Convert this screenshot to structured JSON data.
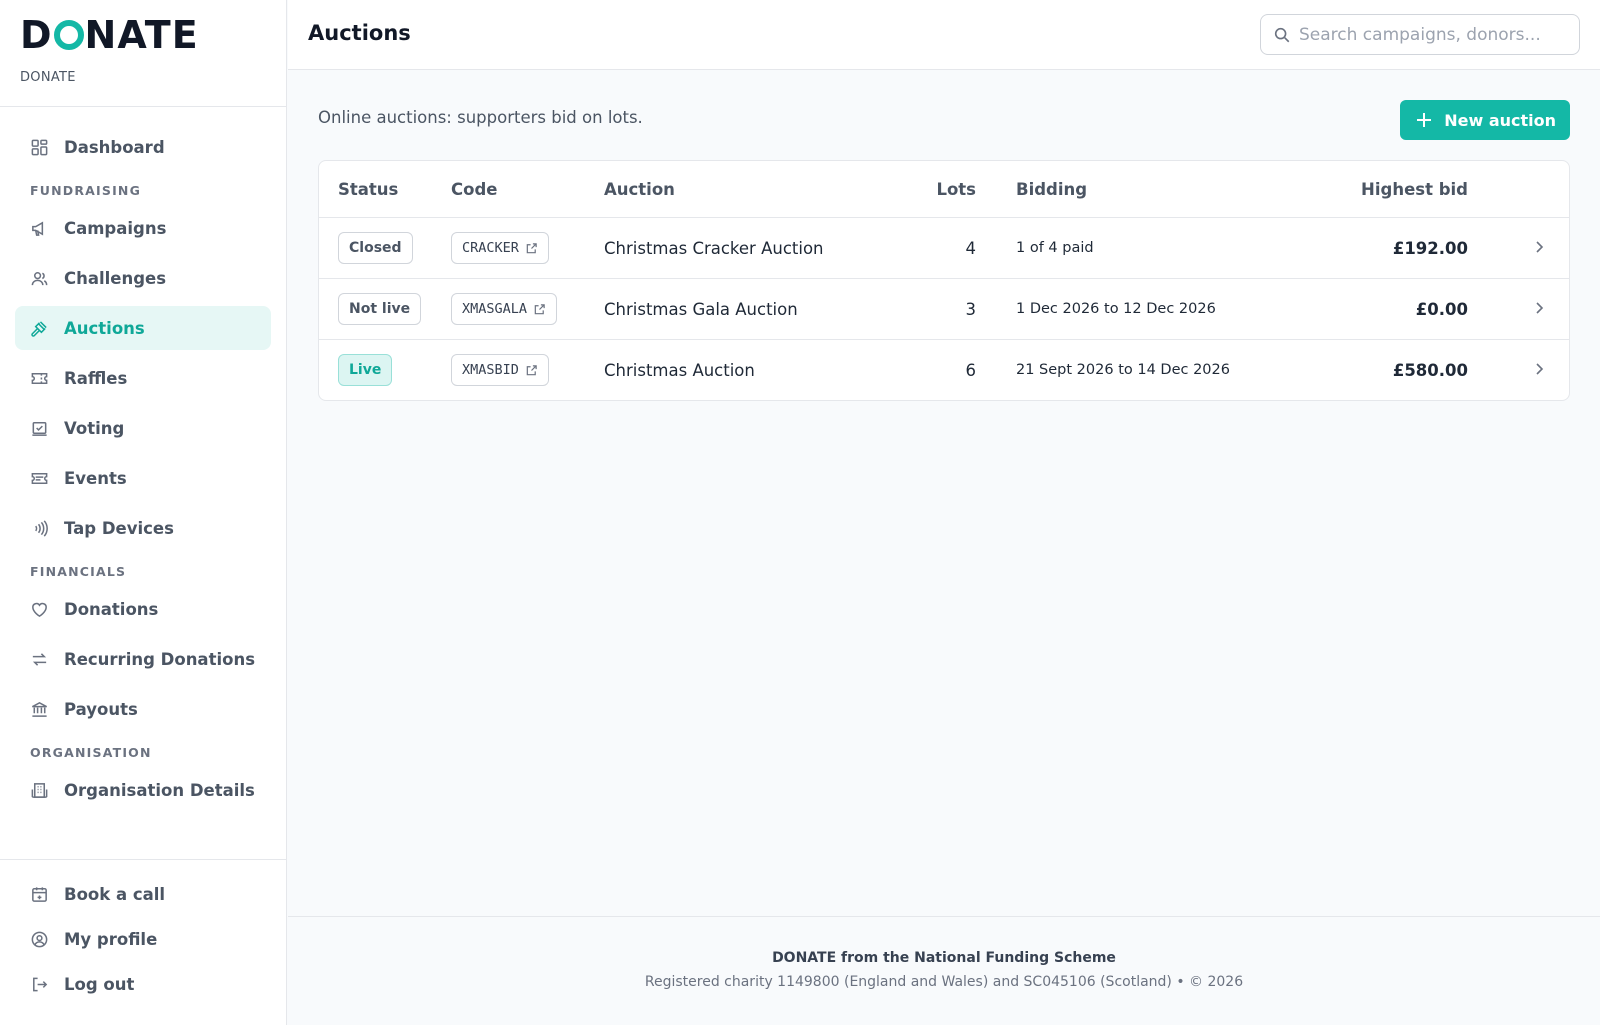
{
  "brand": {
    "logo": "DONATE",
    "subtitle": "DONATE"
  },
  "header": {
    "title": "Auctions",
    "search_placeholder": "Search campaigns, donors..."
  },
  "nav": {
    "dashboard": "Dashboard",
    "section_fundraising": "FUNDRAISING",
    "campaigns": "Campaigns",
    "challenges": "Challenges",
    "auctions": "Auctions",
    "raffles": "Raffles",
    "voting": "Voting",
    "events": "Events",
    "tap_devices": "Tap Devices",
    "section_financials": "FINANCIALS",
    "donations": "Donations",
    "recurring_donations": "Recurring Donations",
    "payouts": "Payouts",
    "section_organisation": "ORGANISATION",
    "organisation_details": "Organisation Details",
    "book_call": "Book a call",
    "my_profile": "My profile",
    "log_out": "Log out"
  },
  "main": {
    "description": "Online auctions: supporters bid on lots.",
    "new_button": "New auction"
  },
  "table": {
    "headers": {
      "status": "Status",
      "code": "Code",
      "auction": "Auction",
      "lots": "Lots",
      "bidding": "Bidding",
      "highest_bid": "Highest bid"
    },
    "rows": [
      {
        "status": "Closed",
        "code": "CRACKER",
        "auction": "Christmas Cracker Auction",
        "lots": "4",
        "bidding": "1 of 4 paid",
        "highest_bid": "£192.00"
      },
      {
        "status": "Not live",
        "code": "XMASGALA",
        "auction": "Christmas Gala Auction",
        "lots": "3",
        "bidding": "1 Dec 2026 to 12 Dec 2026",
        "highest_bid": "£0.00"
      },
      {
        "status": "Live",
        "code": "XMASBID",
        "auction": "Christmas Auction",
        "lots": "6",
        "bidding": "21 Sept 2026 to 14 Dec 2026",
        "highest_bid": "£580.00"
      }
    ]
  },
  "footer": {
    "title": "DONATE from the National Funding Scheme",
    "line": "Registered charity 1149800 (England and Wales) and SC045106 (Scotland)  •  © 2026"
  },
  "colors": {
    "accent": "#14b8a6",
    "active_bg": "#e6f7f5",
    "live_badge_bg": "#dcf5f2"
  }
}
